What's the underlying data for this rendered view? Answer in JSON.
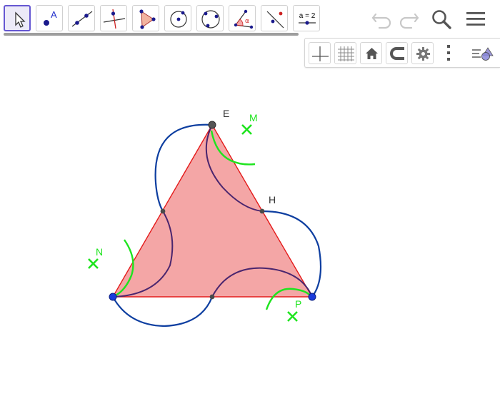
{
  "app": {
    "name": "GeoGebra Geometry"
  },
  "toolbar": {
    "tools": [
      {
        "name": "move-tool",
        "icon": "cursor-arrow-icon",
        "selected": true
      },
      {
        "name": "point-tool",
        "icon": "point-A-icon",
        "label": "A"
      },
      {
        "name": "line-tool",
        "icon": "line-through-points-icon"
      },
      {
        "name": "perpendicular-line-tool",
        "icon": "perpendicular-line-icon"
      },
      {
        "name": "polygon-tool",
        "icon": "polygon-icon"
      },
      {
        "name": "circle-center-point-tool",
        "icon": "circle-center-icon"
      },
      {
        "name": "circle-three-points-tool",
        "icon": "circle-three-points-icon"
      },
      {
        "name": "angle-tool",
        "icon": "angle-alpha-icon",
        "label": "α"
      },
      {
        "name": "reflect-tool",
        "icon": "reflect-about-line-icon"
      },
      {
        "name": "slider-tool",
        "icon": "slider-icon",
        "label": "a = 2"
      }
    ],
    "undo_icon": "undo-icon",
    "redo_icon": "redo-icon",
    "search_icon": "search-icon",
    "menu_icon": "hamburger-menu-icon"
  },
  "graphics_toolbar": {
    "buttons": [
      {
        "name": "axes-toggle",
        "icon": "axes-icon"
      },
      {
        "name": "grid-toggle",
        "icon": "grid-icon"
      },
      {
        "name": "standard-view",
        "icon": "home-icon"
      },
      {
        "name": "point-capturing",
        "icon": "magnet-icon"
      },
      {
        "name": "graphics-settings",
        "icon": "gear-icon"
      },
      {
        "name": "more-options",
        "icon": "vertical-dots-icon"
      },
      {
        "name": "style-bar-toggle",
        "icon": "style-bar-icon"
      }
    ]
  },
  "construction": {
    "points": {
      "E": "E",
      "H": "H",
      "M": "M",
      "N": "N",
      "P": "P"
    },
    "colors": {
      "triangle_fill": "#f4a6a6",
      "triangle_stroke": "#e41b1b",
      "outer_arc": "#0d3ea0",
      "inner_arc": "#4a256e",
      "green": "#1ee41e",
      "vertex_blue": "#1a3bdb",
      "vertex_gray": "#555555"
    }
  }
}
